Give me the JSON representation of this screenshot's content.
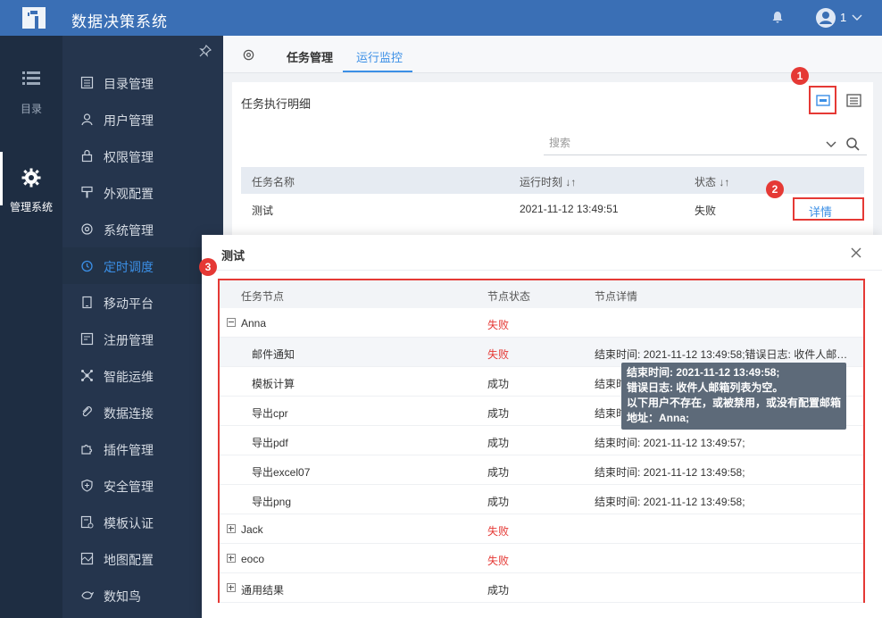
{
  "app": {
    "title": "数据决策系统",
    "user_name": "1"
  },
  "rail": {
    "items": [
      {
        "label": "目录"
      },
      {
        "label": "管理系统"
      }
    ]
  },
  "menu": {
    "items": [
      {
        "label": "目录管理",
        "icon": "catalog-icon"
      },
      {
        "label": "用户管理",
        "icon": "user-icon"
      },
      {
        "label": "权限管理",
        "icon": "lock-icon"
      },
      {
        "label": "外观配置",
        "icon": "brush-icon"
      },
      {
        "label": "系统管理",
        "icon": "gear-icon"
      },
      {
        "label": "定时调度",
        "icon": "clock-icon"
      },
      {
        "label": "移动平台",
        "icon": "mobile-icon"
      },
      {
        "label": "注册管理",
        "icon": "register-icon"
      },
      {
        "label": "智能运维",
        "icon": "network-icon"
      },
      {
        "label": "数据连接",
        "icon": "link-icon"
      },
      {
        "label": "插件管理",
        "icon": "puzzle-icon"
      },
      {
        "label": "安全管理",
        "icon": "shield-icon"
      },
      {
        "label": "模板认证",
        "icon": "template-icon"
      },
      {
        "label": "地图配置",
        "icon": "map-icon"
      },
      {
        "label": "数知鸟",
        "icon": "bird-icon"
      }
    ],
    "active_index": 5
  },
  "tabs": [
    {
      "label": "任务管理"
    },
    {
      "label": "运行监控"
    }
  ],
  "panel": {
    "title": "任务执行明细",
    "search_placeholder": "搜索",
    "columns": [
      "任务名称",
      "运行时刻 ↓↑",
      "状态 ↓↑"
    ],
    "rows": [
      {
        "name": "测试",
        "time": "2021-11-12 13:49:51",
        "status": "失败",
        "action": "详情"
      }
    ]
  },
  "badges": [
    "1",
    "2",
    "3"
  ],
  "dialog": {
    "title": "测试",
    "columns": [
      "任务节点",
      "节点状态",
      "节点详情"
    ],
    "rows": [
      {
        "node": "Anna",
        "status": "失败",
        "detail": "",
        "level": 0,
        "tree": "minus"
      },
      {
        "node": "邮件通知",
        "status": "失败",
        "detail": "结束时间: 2021-11-12 13:49:58;错误日志: 收件人邮…",
        "level": 1
      },
      {
        "node": "模板计算",
        "status": "成功",
        "detail": "结束时间: 2021-11-12 13:49:57;",
        "level": 1
      },
      {
        "node": "导出cpr",
        "status": "成功",
        "detail": "结束时间: 2021-11-12 13:49:57;",
        "level": 1
      },
      {
        "node": "导出pdf",
        "status": "成功",
        "detail": "结束时间: 2021-11-12 13:49:57;",
        "level": 1
      },
      {
        "node": "导出excel07",
        "status": "成功",
        "detail": "结束时间: 2021-11-12 13:49:58;",
        "level": 1
      },
      {
        "node": "导出png",
        "status": "成功",
        "detail": "结束时间: 2021-11-12 13:49:58;",
        "level": 1
      },
      {
        "node": "Jack",
        "status": "失败",
        "detail": "",
        "level": 0,
        "tree": "plus"
      },
      {
        "node": "eoco",
        "status": "失败",
        "detail": "",
        "level": 0,
        "tree": "plus"
      },
      {
        "node": "通用结果",
        "status": "成功",
        "detail": "",
        "level": 0,
        "tree": "plus"
      }
    ],
    "tooltip": [
      "结束时间: 2021-11-12 13:49:58;",
      "错误日志: 收件人邮箱列表为空。",
      "以下用户不存在，或被禁用，或没有配置邮箱",
      "地址：Anna;"
    ]
  }
}
